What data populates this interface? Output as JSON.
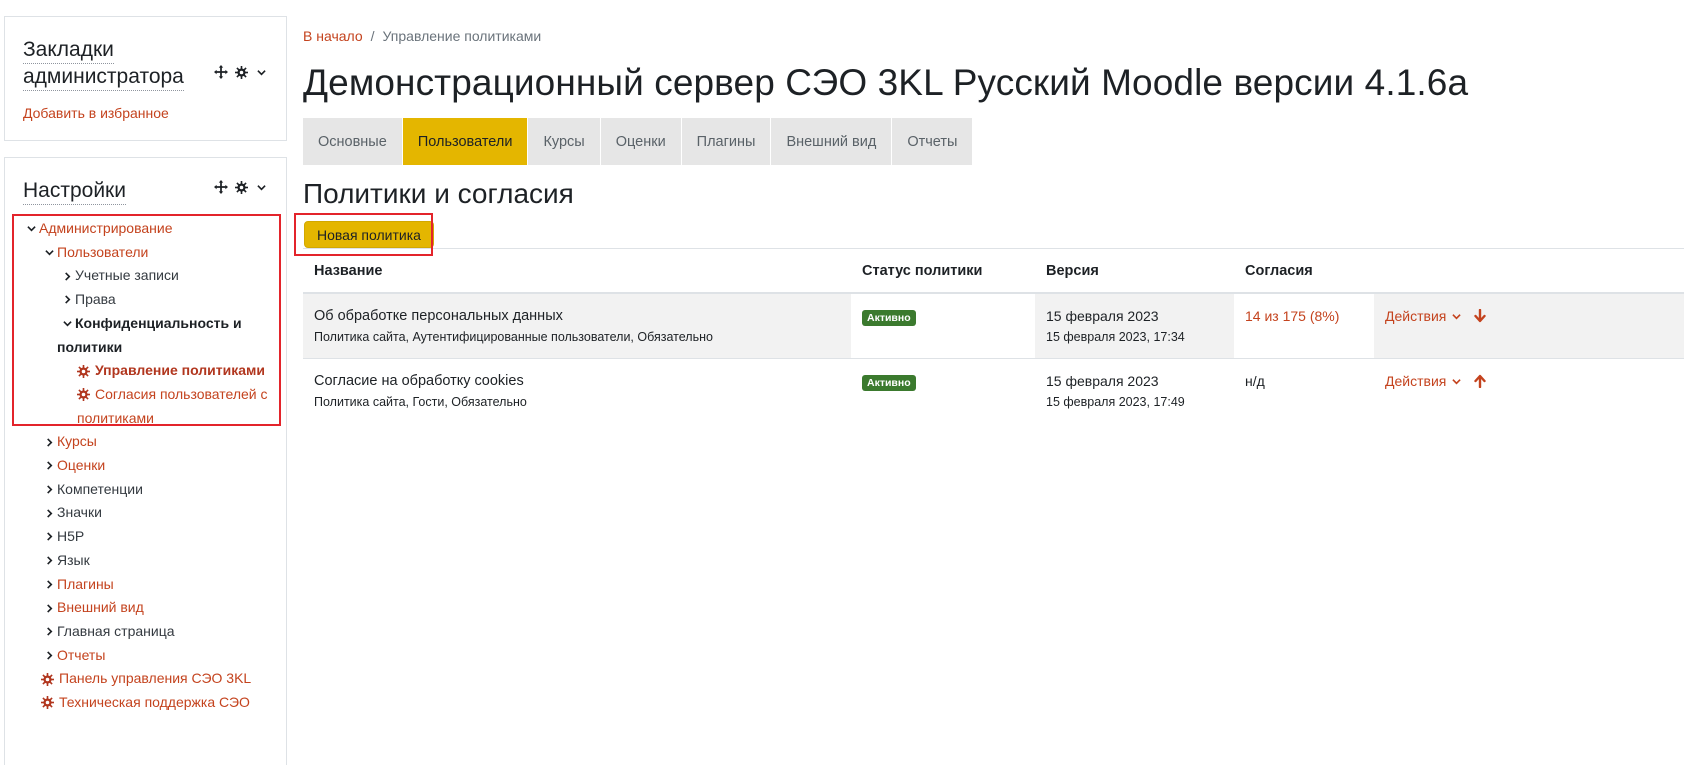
{
  "bookmarks": {
    "title_line1": "Закладки",
    "title_line2": "администратора",
    "add_link": "Добавить в избранное"
  },
  "settings": {
    "title": "Настройки",
    "tree": {
      "admin": "Администрирование",
      "users": "Пользователи",
      "accounts": "Учетные записи",
      "rights": "Права",
      "privacy_line1": "Конфиденциальность и",
      "privacy_line2": "политики",
      "manage_policies": "Управление политиками",
      "user_consents_line1": "Согласия пользователей с",
      "user_consents_line2": "политиками",
      "courses": "Курсы",
      "grades": "Оценки",
      "competencies": "Компетенции",
      "badges": "Значки",
      "h5p": "H5P",
      "language": "Язык",
      "plugins": "Плагины",
      "appearance": "Внешний вид",
      "front_page": "Главная страница",
      "reports": "Отчеты",
      "control_panel": "Панель управления СЭО 3KL",
      "tech_support": "Техническая поддержка СЭО"
    }
  },
  "breadcrumb": {
    "home": "В начало",
    "separator": "/",
    "current": "Управление политиками"
  },
  "page_title": "Демонстрационный сервер СЭО 3KL Русский Moodle версии 4.1.6а",
  "tabs": [
    {
      "label": "Основные"
    },
    {
      "label": "Пользователи"
    },
    {
      "label": "Курсы"
    },
    {
      "label": "Оценки"
    },
    {
      "label": "Плагины"
    },
    {
      "label": "Внешний вид"
    },
    {
      "label": "Отчеты"
    }
  ],
  "section_title": "Политики и согласия",
  "new_policy_button": "Новая политика",
  "table": {
    "headers": {
      "name": "Название",
      "status": "Статус политики",
      "version": "Версия",
      "consents": "Согласия"
    },
    "rows": [
      {
        "name": "Об обработке персональных данных",
        "sub": "Политика сайта, Аутентифицированные пользователи, Обязательно",
        "status": "Активно",
        "version_date": "15 февраля 2023",
        "version_time": "15 февраля 2023, 17:34",
        "consents": "14 из 175 (8%)",
        "actions": "Действия"
      },
      {
        "name": "Согласие на обработку cookies",
        "sub": "Политика сайта, Гости, Обязательно",
        "status": "Активно",
        "version_date": "15 февраля 2023",
        "version_time": "15 февраля 2023, 17:49",
        "consents": "н/д",
        "actions": "Действия"
      }
    ]
  },
  "colors": {
    "accent": "#e4b600",
    "link": "#c4431e",
    "badge_active": "#3b7a2e",
    "highlight_box": "#e3242b"
  }
}
